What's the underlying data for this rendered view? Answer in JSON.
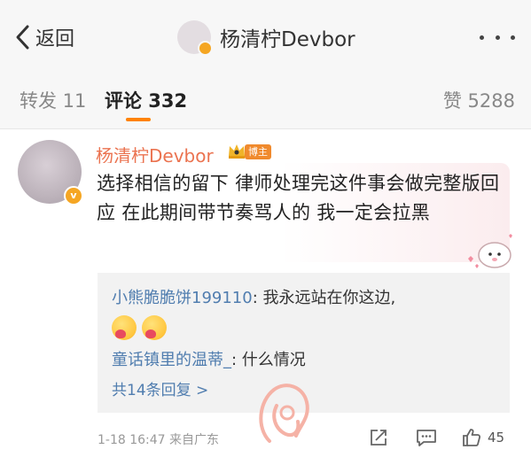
{
  "nav": {
    "back_label": "返回",
    "title": "杨清柠Devbor"
  },
  "tabs": {
    "repost": "转发 11",
    "comments": "评论 332",
    "likes": "赞 5288"
  },
  "comment": {
    "username": "杨清柠Devbor",
    "badge": "博主",
    "text": "选择相信的留下 律师处理完这件事会做完整版回应 在此期间带节奏骂人的 我一定会拉黑",
    "time": "1-18 16:47",
    "source": "来自广东",
    "like_count": "45"
  },
  "replies": [
    {
      "author": "小熊脆脆饼199110",
      "text": ": 我永远站在你这边,"
    },
    {
      "author": "童话镇里的温蒂_",
      "text": ": 什么情况"
    }
  ],
  "more_replies": "共14条回复 >",
  "colors": {
    "username": "#eb7350",
    "link": "#507daf",
    "accent": "#ff8200"
  }
}
